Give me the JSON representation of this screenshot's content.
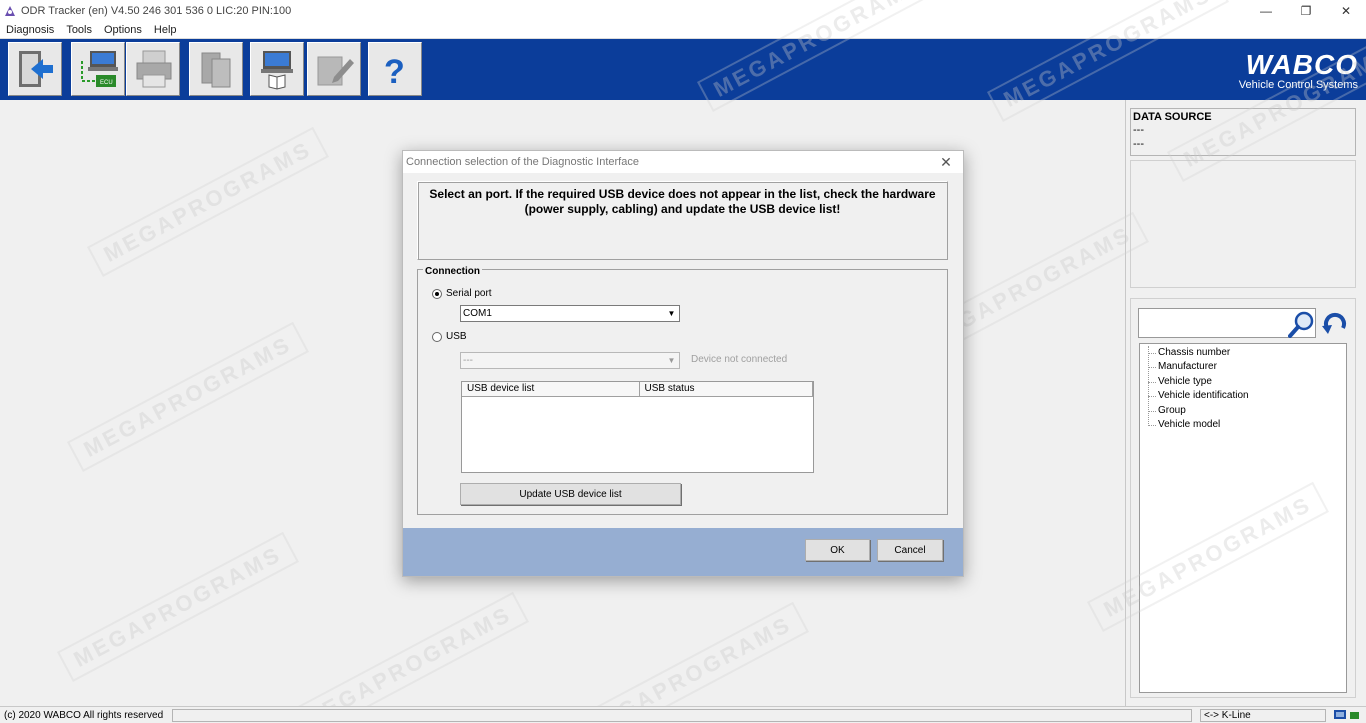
{
  "window": {
    "title": "ODR Tracker (en) V4.50  246 301 536 0  LIC:20 PIN:100",
    "minimize": "—",
    "restore": "❐",
    "close": "✕"
  },
  "menu": [
    "Diagnosis",
    "Tools",
    "Options",
    "Help"
  ],
  "toolbar": {
    "buttons": [
      {
        "name": "exit-icon"
      },
      {
        "name": "ecu-connect-icon"
      },
      {
        "name": "print-icon"
      },
      {
        "name": "documents-icon"
      },
      {
        "name": "laptop-manual-icon"
      },
      {
        "name": "edit-icon"
      },
      {
        "name": "help-icon",
        "glyph": "?"
      }
    ]
  },
  "brand": {
    "name": "WABCO",
    "tagline": "Vehicle Control Systems",
    "color": "#0b3d9a"
  },
  "data_source": {
    "title": "DATA SOURCE",
    "line1": "---",
    "line2": "---"
  },
  "tree": {
    "items": [
      "Chassis number",
      "Manufacturer",
      "Vehicle type",
      "Vehicle identification",
      "Group",
      "Vehicle model"
    ]
  },
  "dialog": {
    "title": "Connection selection of the Diagnostic Interface",
    "close": "✕",
    "message_line1": "Select an port. If the required USB device does not appear in the list, check the hardware",
    "message_line2": "(power supply, cabling) and update the USB device list!",
    "connection_title": "Connection",
    "serial_label": "Serial port",
    "serial_value": "COM1",
    "usb_label": "USB",
    "usb_value": "---",
    "usb_status": "Device not connected",
    "usb_columns": [
      "USB device list",
      "USB status"
    ],
    "update_button": "Update USB device list",
    "ok_button": "OK",
    "cancel_button": "Cancel"
  },
  "status": {
    "copyright": "(c) 2020 WABCO All rights reserved",
    "kline": "<-> K-Line"
  },
  "watermark": "MEGAPROGRAMS"
}
